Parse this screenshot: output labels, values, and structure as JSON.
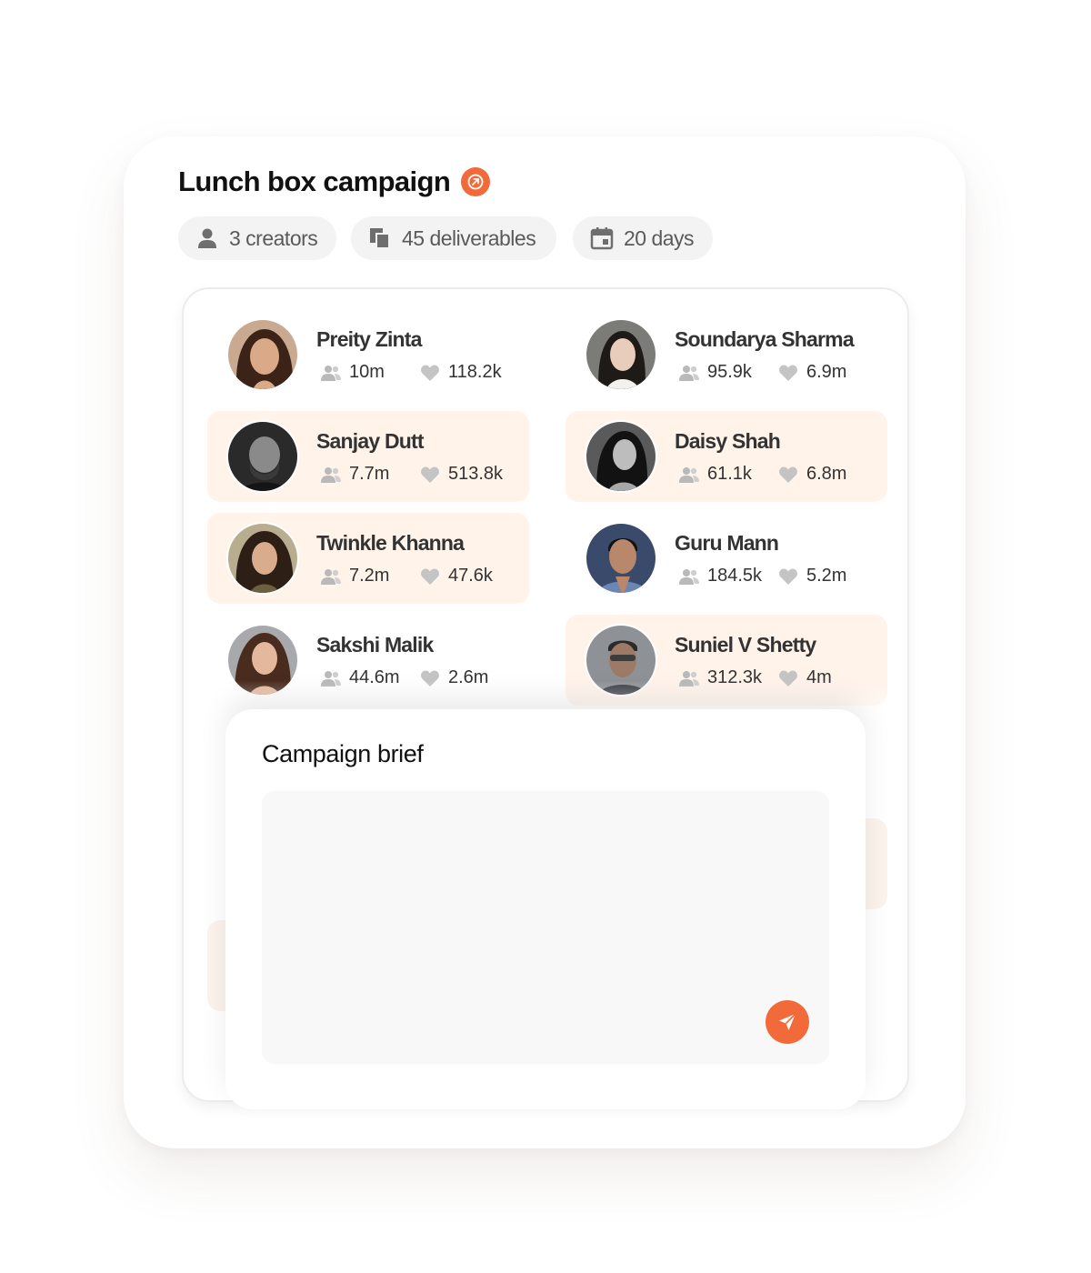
{
  "campaign": {
    "title": "Lunch box campaign",
    "open_icon": "arrow-up-right-icon",
    "accent": "#f26a3a"
  },
  "summary": {
    "creators": "3 creators",
    "deliverables": "45 deliverables",
    "duration": "20 days"
  },
  "creators": [
    {
      "name": "Preity Zinta",
      "followers": "10m",
      "likes": "118.2k",
      "highlighted": false
    },
    {
      "name": "Soundarya Sharma",
      "followers": "95.9k",
      "likes": "6.9m",
      "highlighted": false
    },
    {
      "name": "Sanjay Dutt",
      "followers": "7.7m",
      "likes": "513.8k",
      "highlighted": true
    },
    {
      "name": "Daisy Shah",
      "followers": "61.1k",
      "likes": "6.8m",
      "highlighted": true
    },
    {
      "name": "Twinkle Khanna",
      "followers": "7.2m",
      "likes": "47.6k",
      "highlighted": true
    },
    {
      "name": "Guru Mann",
      "followers": "184.5k",
      "likes": "5.2m",
      "highlighted": false
    },
    {
      "name": "Sakshi Malik",
      "followers": "44.6m",
      "likes": "2.6m",
      "highlighted": false
    },
    {
      "name": "Suniel V Shetty",
      "followers": "312.3k",
      "likes": "4m",
      "highlighted": true
    }
  ],
  "brief": {
    "title": "Campaign brief",
    "value": "",
    "send_icon": "send-icon"
  },
  "colors": {
    "highlight": "#fff3ea",
    "pill_bg": "#f3f3f3"
  }
}
